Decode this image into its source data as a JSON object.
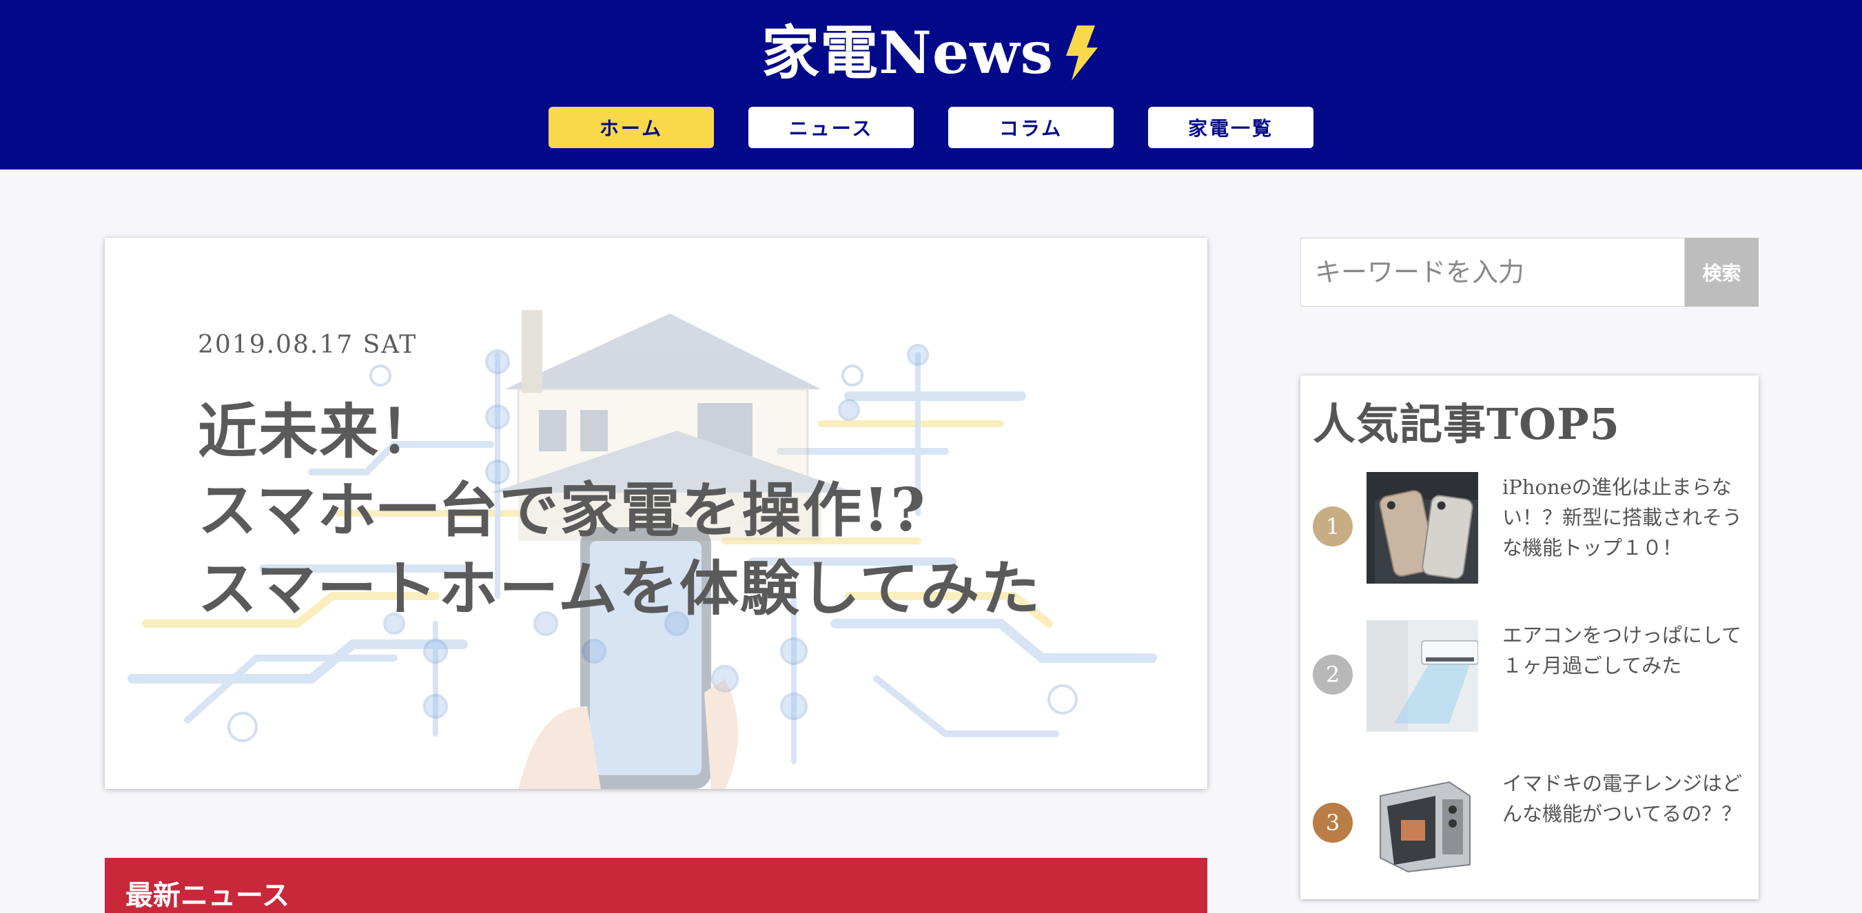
{
  "site": {
    "logo_text": "家電News",
    "logo_icon": "lightning-bolt-icon",
    "colors": {
      "header_bg": "#020a8a",
      "nav_active": "#f9d94a",
      "latest_bar": "#c8283a",
      "rank_1": "#c8ad84",
      "rank_2": "#b8b8b8",
      "rank_3": "#b97d45"
    }
  },
  "nav": {
    "items": [
      {
        "label": "ホーム",
        "active": true
      },
      {
        "label": "ニュース",
        "active": false
      },
      {
        "label": "コラム",
        "active": false
      },
      {
        "label": "家電一覧",
        "active": false
      }
    ]
  },
  "hero": {
    "date": "2019.08.17 SAT",
    "title_lines": [
      "近未来！",
      "スマホ一台で家電を操作!?",
      "スマートホームを体験してみた"
    ]
  },
  "latest": {
    "title": "最新ニュース"
  },
  "search": {
    "placeholder": "キーワードを入力",
    "button": "検索"
  },
  "ranking": {
    "title": "人気記事TOP5",
    "items": [
      {
        "rank": "1",
        "title": "iPhoneの進化は止まらない！？新型に搭載されそうな機能トップ１０！",
        "thumb": "smartphones-photo"
      },
      {
        "rank": "2",
        "title": "エアコンをつけっぱにして１ヶ月過ごしてみた",
        "thumb": "air-conditioner-photo"
      },
      {
        "rank": "3",
        "title": "イマドキの電子レンジはどんな機能がついてるの？？",
        "thumb": "microwave-photo"
      }
    ]
  }
}
